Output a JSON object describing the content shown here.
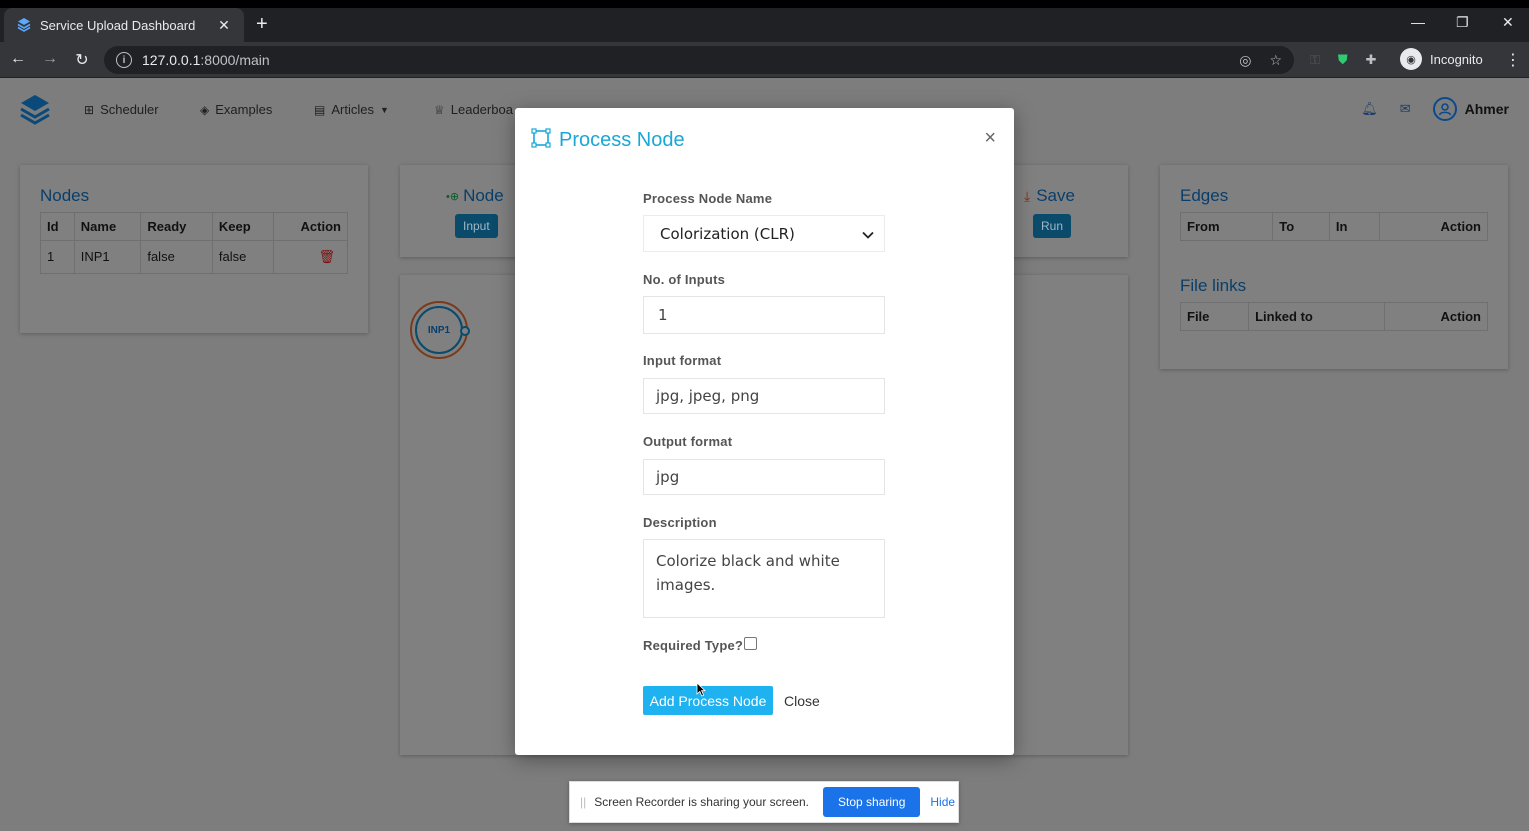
{
  "browser": {
    "tab_title": "Service Upload Dashboard",
    "tab_close": "✕",
    "new_tab": "+",
    "url_host": "127.0.0.1",
    "url_rest": ":8000/main",
    "profile_label": "Incognito",
    "win_minimize": "—",
    "win_restore": "❐",
    "win_close": "✕"
  },
  "app_nav": {
    "links": [
      {
        "icon": "sitemap-icon",
        "label": "Scheduler"
      },
      {
        "icon": "layers-icon",
        "label": "Examples"
      },
      {
        "icon": "newspaper-icon",
        "label": "Articles"
      },
      {
        "icon": "trophy-icon",
        "label": "Leaderboa"
      }
    ],
    "user_name": "Ahmer"
  },
  "nodes_card": {
    "title": "Nodes",
    "columns": [
      "Id",
      "Name",
      "Ready",
      "Keep",
      "Action"
    ],
    "rows": [
      {
        "id": "1",
        "name": "INP1",
        "ready": "false",
        "keep": "false"
      }
    ]
  },
  "node_card": {
    "title": "Node",
    "button": "Input"
  },
  "save_card": {
    "title": "Save",
    "button": "Run"
  },
  "canvas": {
    "node_label": "INP1"
  },
  "edges_card": {
    "title": "Edges",
    "columns": [
      "From",
      "To",
      "In",
      "Action"
    ]
  },
  "filelinks_card": {
    "title": "File links",
    "columns": [
      "File",
      "Linked to",
      "Action"
    ]
  },
  "modal": {
    "title": "Process Node",
    "close_x": "×",
    "process_node_name_label": "Process Node Name",
    "process_node_name_value": "Colorization (CLR)",
    "inputs_label": "No. of Inputs",
    "inputs_value": "1",
    "input_format_label": "Input format",
    "input_format_value": "jpg, jpeg, png",
    "output_format_label": "Output format",
    "output_format_value": "jpg",
    "description_label": "Description",
    "description_value": "Colorize black and white images.",
    "required_type_label": "Required Type?",
    "add_button": "Add Process Node",
    "close_button": "Close",
    "accent_color": "#19a7d8"
  },
  "share_bar": {
    "message": "Screen Recorder is sharing your screen.",
    "stop_button": "Stop sharing",
    "hide_button": "Hide"
  }
}
